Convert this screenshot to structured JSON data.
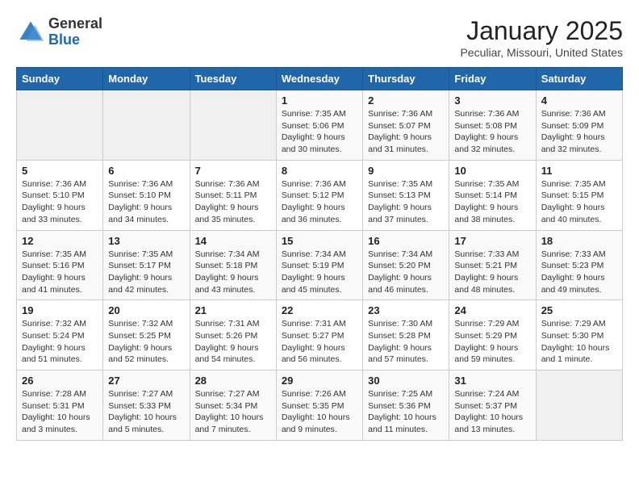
{
  "header": {
    "logo_line1": "General",
    "logo_line2": "Blue",
    "month": "January 2025",
    "location": "Peculiar, Missouri, United States"
  },
  "days_of_week": [
    "Sunday",
    "Monday",
    "Tuesday",
    "Wednesday",
    "Thursday",
    "Friday",
    "Saturday"
  ],
  "weeks": [
    [
      {
        "day": "",
        "info": ""
      },
      {
        "day": "",
        "info": ""
      },
      {
        "day": "",
        "info": ""
      },
      {
        "day": "1",
        "info": "Sunrise: 7:35 AM\nSunset: 5:06 PM\nDaylight: 9 hours\nand 30 minutes."
      },
      {
        "day": "2",
        "info": "Sunrise: 7:36 AM\nSunset: 5:07 PM\nDaylight: 9 hours\nand 31 minutes."
      },
      {
        "day": "3",
        "info": "Sunrise: 7:36 AM\nSunset: 5:08 PM\nDaylight: 9 hours\nand 32 minutes."
      },
      {
        "day": "4",
        "info": "Sunrise: 7:36 AM\nSunset: 5:09 PM\nDaylight: 9 hours\nand 32 minutes."
      }
    ],
    [
      {
        "day": "5",
        "info": "Sunrise: 7:36 AM\nSunset: 5:10 PM\nDaylight: 9 hours\nand 33 minutes."
      },
      {
        "day": "6",
        "info": "Sunrise: 7:36 AM\nSunset: 5:10 PM\nDaylight: 9 hours\nand 34 minutes."
      },
      {
        "day": "7",
        "info": "Sunrise: 7:36 AM\nSunset: 5:11 PM\nDaylight: 9 hours\nand 35 minutes."
      },
      {
        "day": "8",
        "info": "Sunrise: 7:36 AM\nSunset: 5:12 PM\nDaylight: 9 hours\nand 36 minutes."
      },
      {
        "day": "9",
        "info": "Sunrise: 7:35 AM\nSunset: 5:13 PM\nDaylight: 9 hours\nand 37 minutes."
      },
      {
        "day": "10",
        "info": "Sunrise: 7:35 AM\nSunset: 5:14 PM\nDaylight: 9 hours\nand 38 minutes."
      },
      {
        "day": "11",
        "info": "Sunrise: 7:35 AM\nSunset: 5:15 PM\nDaylight: 9 hours\nand 40 minutes."
      }
    ],
    [
      {
        "day": "12",
        "info": "Sunrise: 7:35 AM\nSunset: 5:16 PM\nDaylight: 9 hours\nand 41 minutes."
      },
      {
        "day": "13",
        "info": "Sunrise: 7:35 AM\nSunset: 5:17 PM\nDaylight: 9 hours\nand 42 minutes."
      },
      {
        "day": "14",
        "info": "Sunrise: 7:34 AM\nSunset: 5:18 PM\nDaylight: 9 hours\nand 43 minutes."
      },
      {
        "day": "15",
        "info": "Sunrise: 7:34 AM\nSunset: 5:19 PM\nDaylight: 9 hours\nand 45 minutes."
      },
      {
        "day": "16",
        "info": "Sunrise: 7:34 AM\nSunset: 5:20 PM\nDaylight: 9 hours\nand 46 minutes."
      },
      {
        "day": "17",
        "info": "Sunrise: 7:33 AM\nSunset: 5:21 PM\nDaylight: 9 hours\nand 48 minutes."
      },
      {
        "day": "18",
        "info": "Sunrise: 7:33 AM\nSunset: 5:23 PM\nDaylight: 9 hours\nand 49 minutes."
      }
    ],
    [
      {
        "day": "19",
        "info": "Sunrise: 7:32 AM\nSunset: 5:24 PM\nDaylight: 9 hours\nand 51 minutes."
      },
      {
        "day": "20",
        "info": "Sunrise: 7:32 AM\nSunset: 5:25 PM\nDaylight: 9 hours\nand 52 minutes."
      },
      {
        "day": "21",
        "info": "Sunrise: 7:31 AM\nSunset: 5:26 PM\nDaylight: 9 hours\nand 54 minutes."
      },
      {
        "day": "22",
        "info": "Sunrise: 7:31 AM\nSunset: 5:27 PM\nDaylight: 9 hours\nand 56 minutes."
      },
      {
        "day": "23",
        "info": "Sunrise: 7:30 AM\nSunset: 5:28 PM\nDaylight: 9 hours\nand 57 minutes."
      },
      {
        "day": "24",
        "info": "Sunrise: 7:29 AM\nSunset: 5:29 PM\nDaylight: 9 hours\nand 59 minutes."
      },
      {
        "day": "25",
        "info": "Sunrise: 7:29 AM\nSunset: 5:30 PM\nDaylight: 10 hours\nand 1 minute."
      }
    ],
    [
      {
        "day": "26",
        "info": "Sunrise: 7:28 AM\nSunset: 5:31 PM\nDaylight: 10 hours\nand 3 minutes."
      },
      {
        "day": "27",
        "info": "Sunrise: 7:27 AM\nSunset: 5:33 PM\nDaylight: 10 hours\nand 5 minutes."
      },
      {
        "day": "28",
        "info": "Sunrise: 7:27 AM\nSunset: 5:34 PM\nDaylight: 10 hours\nand 7 minutes."
      },
      {
        "day": "29",
        "info": "Sunrise: 7:26 AM\nSunset: 5:35 PM\nDaylight: 10 hours\nand 9 minutes."
      },
      {
        "day": "30",
        "info": "Sunrise: 7:25 AM\nSunset: 5:36 PM\nDaylight: 10 hours\nand 11 minutes."
      },
      {
        "day": "31",
        "info": "Sunrise: 7:24 AM\nSunset: 5:37 PM\nDaylight: 10 hours\nand 13 minutes."
      },
      {
        "day": "",
        "info": ""
      }
    ]
  ]
}
